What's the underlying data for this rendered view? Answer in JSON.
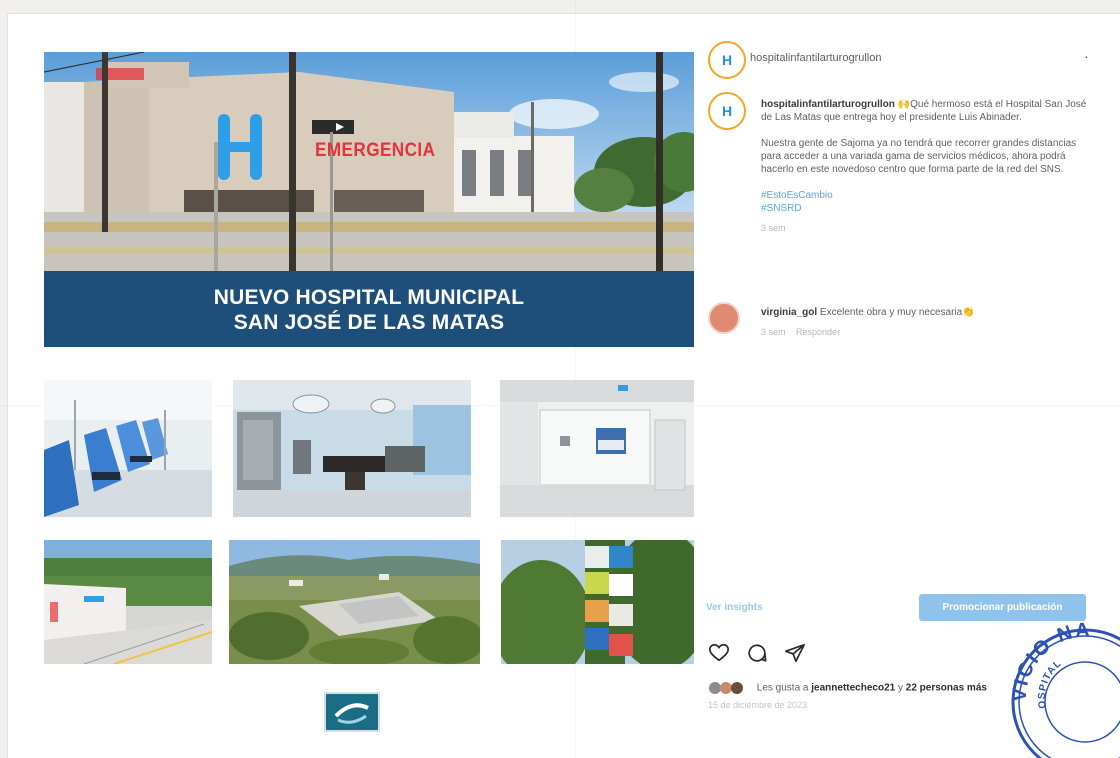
{
  "post": {
    "hero": {
      "sign_text": "EMERGENCIA",
      "banner_line1": "NUEVO HOSPITAL MUNICIPAL",
      "banner_line2": "SAN JOSÉ DE LAS MATAS"
    },
    "thumbnails": [
      {
        "subject": "dialysis-chairs"
      },
      {
        "subject": "operating-room"
      },
      {
        "subject": "patient-room"
      },
      {
        "subject": "building-aerial"
      },
      {
        "subject": "town-aerial"
      },
      {
        "subject": "sajoma-letters"
      }
    ]
  },
  "panel": {
    "top_username": "hospitalinfantilarturogrullon",
    "caption": {
      "username": "hospitalinfantilarturogrullon",
      "emoji": "🙌",
      "text_1": "Qué hermoso está el Hospital San José de Las Matas que entrega hoy el presidente Luis Abinader.",
      "text_2": "Nuestra gente de Sajoma ya no tendrá que recorrer grandes distancias para acceder a una variada gama de servicios médicos, ahora podrá hacerlo en este novedoso centro que forma parte de la red del SNS.",
      "hashtags": [
        "#EstoEsCambio",
        "#SNSRD"
      ],
      "time": "3 sem"
    },
    "comment": {
      "username": "virginia_gol",
      "text": "Excelente obra y muy necesaria",
      "emoji": "👏",
      "time": "3 sem",
      "reply_label": "Responder"
    },
    "insights_label": "Ver insights",
    "promote_label": "Promocionar publicación",
    "likes": {
      "prefix": "Les gusta a",
      "user": "jeannettecheco21",
      "suffix": "y",
      "others": "22 personas más"
    },
    "date": "15 de diciembre de 2023"
  },
  "stamp": {
    "line1": "VICIO NA",
    "line2": "OSPITAL"
  },
  "colors": {
    "banner_blue": "#1d4f7a",
    "link_blue": "#5aa5e0",
    "promote_blue": "#90c3ec",
    "avatar_ring": "#f5a623",
    "sign_red": "#e4333b",
    "stamp_blue": "#2d52b3"
  },
  "icons": [
    "heart-icon",
    "comment-icon",
    "share-icon",
    "more-icon"
  ]
}
